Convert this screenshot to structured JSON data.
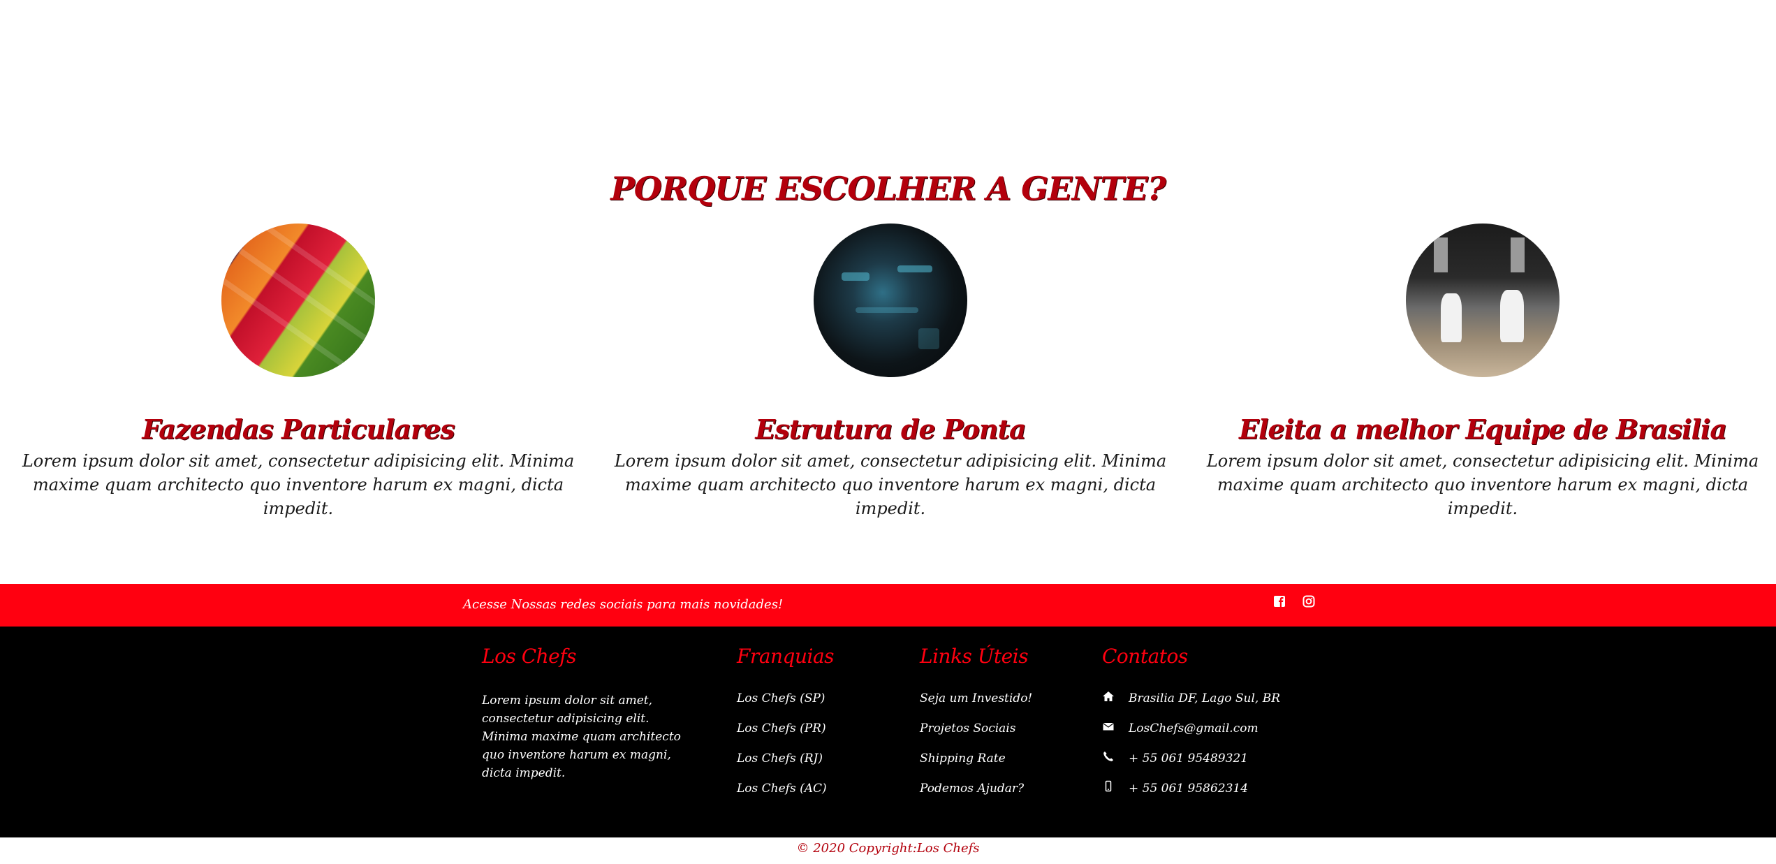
{
  "section": {
    "title": "PORQUE ESCOLHER A GENTE?",
    "features": [
      {
        "title": "Fazendas Particulares",
        "text": "Lorem ipsum dolor sit amet, consectetur adipisicing elit. Minima maxime quam architecto quo inventore harum ex magni, dicta impedit."
      },
      {
        "title": "Estrutura de Ponta",
        "text": "Lorem ipsum dolor sit amet, consectetur adipisicing elit. Minima maxime quam architecto quo inventore harum ex magni, dicta impedit."
      },
      {
        "title": "Eleita a melhor Equipe de Brasilia",
        "text": "Lorem ipsum dolor sit amet, consectetur adipisicing elit. Minima maxime quam architecto quo inventore harum ex magni, dicta impedit."
      }
    ]
  },
  "social": {
    "text": "Acesse Nossas redes sociais para mais novidades!",
    "icons": [
      "facebook-icon",
      "instagram-icon"
    ]
  },
  "footer": {
    "brand": {
      "title": "Los Chefs",
      "text": "Lorem ipsum dolor sit amet, consectetur adipisicing elit. Minima maxime quam architecto quo inventore harum ex magni, dicta impedit."
    },
    "franchises": {
      "title": "Franquias",
      "items": [
        "Los Chefs (SP)",
        "Los Chefs (PR)",
        "Los Chefs (RJ)",
        "Los Chefs (AC)"
      ]
    },
    "links": {
      "title": "Links Úteis",
      "items": [
        "Seja um Investido!",
        "Projetos Sociais",
        "Shipping Rate",
        "Podemos Ajudar?"
      ]
    },
    "contacts": {
      "title": "Contatos",
      "items": [
        {
          "icon": "home-icon",
          "text": "Brasilia DF, Lago Sul, BR"
        },
        {
          "icon": "envelope-icon",
          "text": "LosChefs@gmail.com"
        },
        {
          "icon": "phone-icon",
          "text": "+ 55 061 95489321"
        },
        {
          "icon": "mobile-icon",
          "text": "+ 55 061 95862314"
        }
      ]
    }
  },
  "copyright": "© 2020 Copyright:Los Chefs",
  "colors": {
    "accent": "#b3000c",
    "bar": "#ff0010",
    "footer_bg": "#000000"
  }
}
